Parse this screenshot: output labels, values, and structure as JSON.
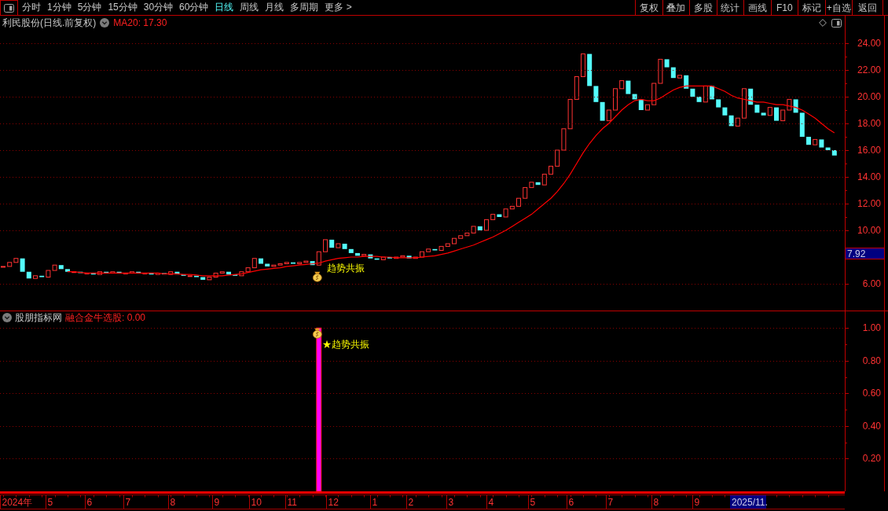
{
  "toolbar": {
    "tabs": [
      {
        "label": "分时",
        "selected": false
      },
      {
        "label": "1分钟",
        "selected": false
      },
      {
        "label": "5分钟",
        "selected": false
      },
      {
        "label": "15分钟",
        "selected": false
      },
      {
        "label": "30分钟",
        "selected": false
      },
      {
        "label": "60分钟",
        "selected": false
      },
      {
        "label": "日线",
        "selected": true
      },
      {
        "label": "周线",
        "selected": false
      },
      {
        "label": "月线",
        "selected": false
      },
      {
        "label": "多周期",
        "selected": false
      },
      {
        "label": "更多 >",
        "selected": false
      }
    ],
    "buttons": [
      "复权",
      "叠加",
      "多股",
      "统计",
      "画线",
      "F10",
      "标记",
      "+自选",
      "返回"
    ]
  },
  "main_chart": {
    "title": "利民股份(日线.前复权)",
    "ma_label": "MA20: 17.30",
    "chart_data": {
      "type": "line",
      "ylim": [
        4,
        25
      ],
      "yticks": [
        {
          "value": 6,
          "label": "6.00"
        },
        {
          "value": 10,
          "label": "10.00"
        },
        {
          "value": 12,
          "label": "12.00"
        },
        {
          "value": 14,
          "label": "14.00"
        },
        {
          "value": 16,
          "label": "16.00"
        },
        {
          "value": 18,
          "label": "18.00"
        },
        {
          "value": 20,
          "label": "20.00"
        },
        {
          "value": 22,
          "label": "22.00"
        },
        {
          "value": 24,
          "label": "24.00"
        }
      ],
      "grid": true,
      "series": [
        {
          "color": "#ff0000",
          "values": [
            null,
            null,
            null,
            null,
            null,
            null,
            null,
            null,
            null,
            null,
            6.9,
            6.9,
            6.85,
            6.8,
            6.8,
            6.8,
            6.8,
            6.8,
            6.8,
            6.8,
            6.8,
            6.8,
            6.8,
            6.8,
            6.8,
            6.75,
            6.75,
            6.75,
            6.7,
            6.7,
            6.65,
            6.6,
            6.6,
            6.6,
            6.6,
            6.65,
            6.7,
            6.75,
            6.85,
            6.95,
            7.05,
            7.1,
            7.15,
            7.2,
            7.3,
            7.35,
            7.4,
            7.45,
            7.5,
            7.55,
            7.7,
            7.8,
            7.9,
            7.95,
            8.0,
            8.0,
            8.05,
            8.05,
            8.05,
            8.0,
            8.0,
            7.95,
            7.95,
            7.95,
            7.95,
            8.0,
            8.05,
            8.1,
            8.2,
            8.3,
            8.45,
            8.6,
            8.75,
            8.9,
            9.1,
            9.3,
            9.5,
            9.75,
            10.0,
            10.3,
            10.6,
            10.9,
            11.2,
            11.6,
            12.0,
            12.4,
            12.9,
            13.5,
            14.2,
            15.0,
            15.8,
            16.5,
            17.1,
            17.6,
            18.0,
            18.5,
            19.0,
            19.4,
            19.7,
            19.8,
            19.7,
            19.7,
            19.9,
            20.2,
            20.5,
            20.7,
            20.8,
            20.8,
            20.8,
            20.8,
            20.8,
            20.6,
            20.4,
            20.1,
            19.9,
            19.8,
            19.7,
            19.6,
            19.6,
            19.5,
            19.4,
            19.4,
            19.3,
            19.2,
            19.0,
            18.7,
            18.4,
            18.0,
            17.6,
            17.3
          ]
        }
      ],
      "annotations": [
        "趋势共振",
        "7.92"
      ]
    }
  },
  "indicator_pane": {
    "source": "股朋指标网",
    "value_label": "融合金牛选股: 0.00",
    "chart_data": {
      "type": "bar",
      "ylim": [
        0,
        1.03
      ],
      "yticks": [
        {
          "value": 0.2,
          "label": "0.20"
        },
        {
          "value": 0.4,
          "label": "0.40"
        },
        {
          "value": 0.6,
          "label": "0.60"
        },
        {
          "value": 0.8,
          "label": "0.80"
        },
        {
          "value": 1.0,
          "label": "1.00"
        }
      ],
      "grid": true,
      "values": [
        0,
        0,
        0,
        0,
        0,
        0,
        0,
        0,
        0,
        0,
        0,
        0,
        0,
        0,
        0,
        0,
        0,
        0,
        0,
        0,
        0,
        0,
        0,
        0,
        0,
        0,
        0,
        0,
        0,
        0,
        0,
        0,
        0,
        0,
        0,
        0,
        0,
        0,
        0,
        0,
        0,
        0,
        0,
        0,
        0,
        0,
        0,
        0,
        0,
        1,
        0,
        0,
        0,
        0,
        0,
        0,
        0,
        0,
        0,
        0,
        0,
        0,
        0,
        0,
        0,
        0,
        0,
        0,
        0,
        0,
        0,
        0,
        0,
        0,
        0,
        0,
        0,
        0,
        0,
        0,
        0,
        0,
        0,
        0,
        0,
        0,
        0,
        0,
        0,
        0,
        0,
        0,
        0,
        0,
        0,
        0,
        0,
        0,
        0,
        0,
        0,
        0,
        0,
        0,
        0,
        0,
        0,
        0,
        0,
        0,
        0,
        0,
        0,
        0,
        0,
        0,
        0,
        0,
        0,
        0,
        0,
        0,
        0,
        0,
        0,
        0,
        0,
        0,
        0,
        0
      ],
      "annotations": [
        "★趋势共振"
      ]
    }
  },
  "time_axis": {
    "labels": [
      "2024年",
      "5",
      "6",
      "7",
      "8",
      "9",
      "10",
      "11",
      "12",
      "1",
      "2",
      "3",
      "4",
      "5",
      "6",
      "7",
      "8",
      "9"
    ],
    "cursor_label": "2025/11."
  }
}
